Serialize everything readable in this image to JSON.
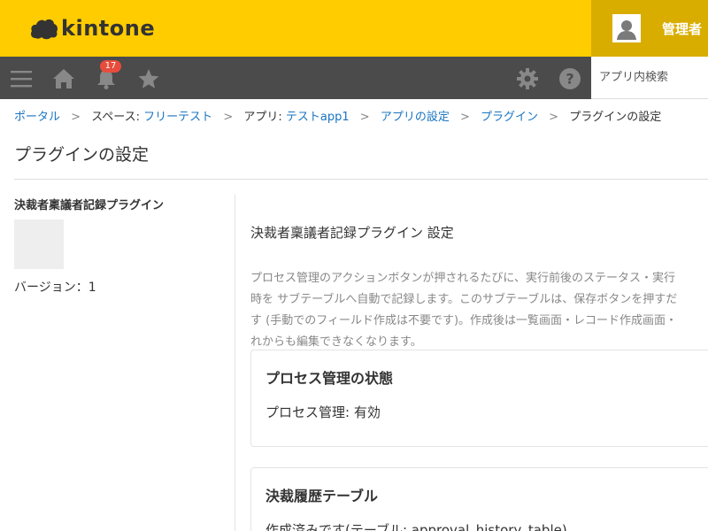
{
  "header": {
    "logo_text": "kintone",
    "user_name": "管理者",
    "brand_color": "#ffcc00"
  },
  "toolbar": {
    "icons": [
      "menu-icon",
      "home-icon",
      "bell-icon",
      "star-icon",
      "gear-icon",
      "help-icon"
    ],
    "notification_count": "17",
    "search_placeholder": "アプリ内検索"
  },
  "breadcrumb": {
    "portal": "ポータル",
    "space_prefix": "スペース: ",
    "space": "フリーテスト",
    "app_prefix": "アプリ: ",
    "app": "テストapp1",
    "app_settings": "アプリの設定",
    "plugins": "プラグイン",
    "current": "プラグインの設定",
    "separator": ">"
  },
  "page": {
    "title": "プラグインの設定"
  },
  "plugin": {
    "name": "決裁者稟議者記録プラグイン",
    "version": "バージョン：1"
  },
  "settings": {
    "title": "決裁者稟議者記録プラグイン 設定",
    "description_lines": [
      "プロセス管理のアクションボタンが押されるたびに、実行前後のステータス・実行",
      "時を サブテーブルへ自動で記録します。このサブテーブルは、保存ボタンを押すだ",
      "す (手動でのフィールド作成は不要です)。作成後は一覧画面・レコード作成画面・",
      "れからも編集できなくなります。"
    ],
    "cards": [
      {
        "title": "プロセス管理の状態",
        "body": "プロセス管理: 有効"
      },
      {
        "title": "決裁履歴テーブル",
        "body": "作成済みです(テーブル: approval_history_table)"
      }
    ]
  }
}
